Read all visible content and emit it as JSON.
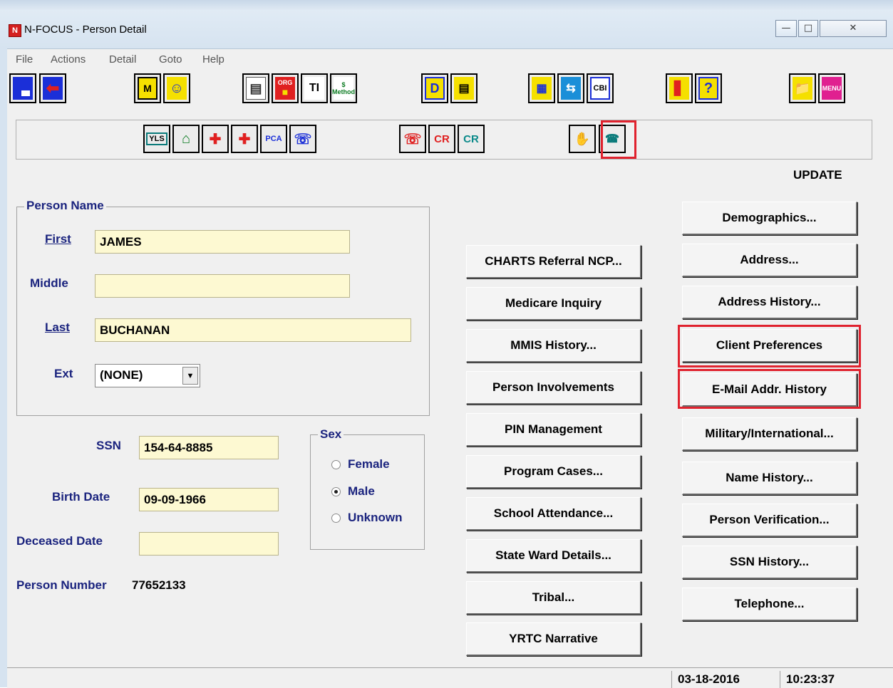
{
  "window": {
    "title": "N-FOCUS - Person Detail",
    "app_icon_letter": "N",
    "controls": [
      "—",
      "□",
      "✕"
    ]
  },
  "menu": [
    "File",
    "Actions",
    "Detail",
    "Goto",
    "Help"
  ],
  "toolbar": {
    "m_label": "M",
    "method_label": "$ Method",
    "org_label": "ORG",
    "d_label": "D",
    "cbi_label": "CBI",
    "menu_label": "MENU"
  },
  "subtoolbar": {
    "yls_label": "YLS",
    "pca_label": "PCA",
    "cr_red_label": "CR",
    "cr_teal_label": "CR"
  },
  "mode": "UPDATE",
  "person_name": {
    "group_title": "Person Name",
    "first_label": "First",
    "first_value": "JAMES",
    "middle_label": "Middle",
    "middle_value": "",
    "last_label": "Last",
    "last_value": "BUCHANAN",
    "ext_label": "Ext",
    "ext_value": "(NONE)"
  },
  "person_info": {
    "ssn_label": "SSN",
    "ssn_value": "154-64-8885",
    "birth_label": "Birth Date",
    "birth_value": "09-09-1966",
    "deceased_label": "Deceased Date",
    "deceased_value": "",
    "number_label": "Person Number",
    "number_value": "77652133"
  },
  "sex": {
    "title": "Sex",
    "options": [
      "Female",
      "Male",
      "Unknown"
    ],
    "selected": "Male"
  },
  "middle_buttons": [
    "CHARTS Referral NCP...",
    "Medicare Inquiry",
    "MMIS History...",
    "Person Involvements",
    "PIN Management",
    "Program Cases...",
    "School Attendance...",
    "State Ward Details...",
    "Tribal...",
    "YRTC Narrative"
  ],
  "right_buttons": [
    "Demographics...",
    "Address...",
    "Address History...",
    "Client Preferences",
    "E-Mail Addr. History",
    "Military/International...",
    "Name History...",
    "Person Verification...",
    "SSN History...",
    "Telephone..."
  ],
  "status": {
    "date": "03-18-2016",
    "time": "10:23:37"
  },
  "colors": {
    "label_blue": "#1a237e",
    "field_yellow": "#fdf9d2",
    "highlight_red": "#e0222e"
  }
}
